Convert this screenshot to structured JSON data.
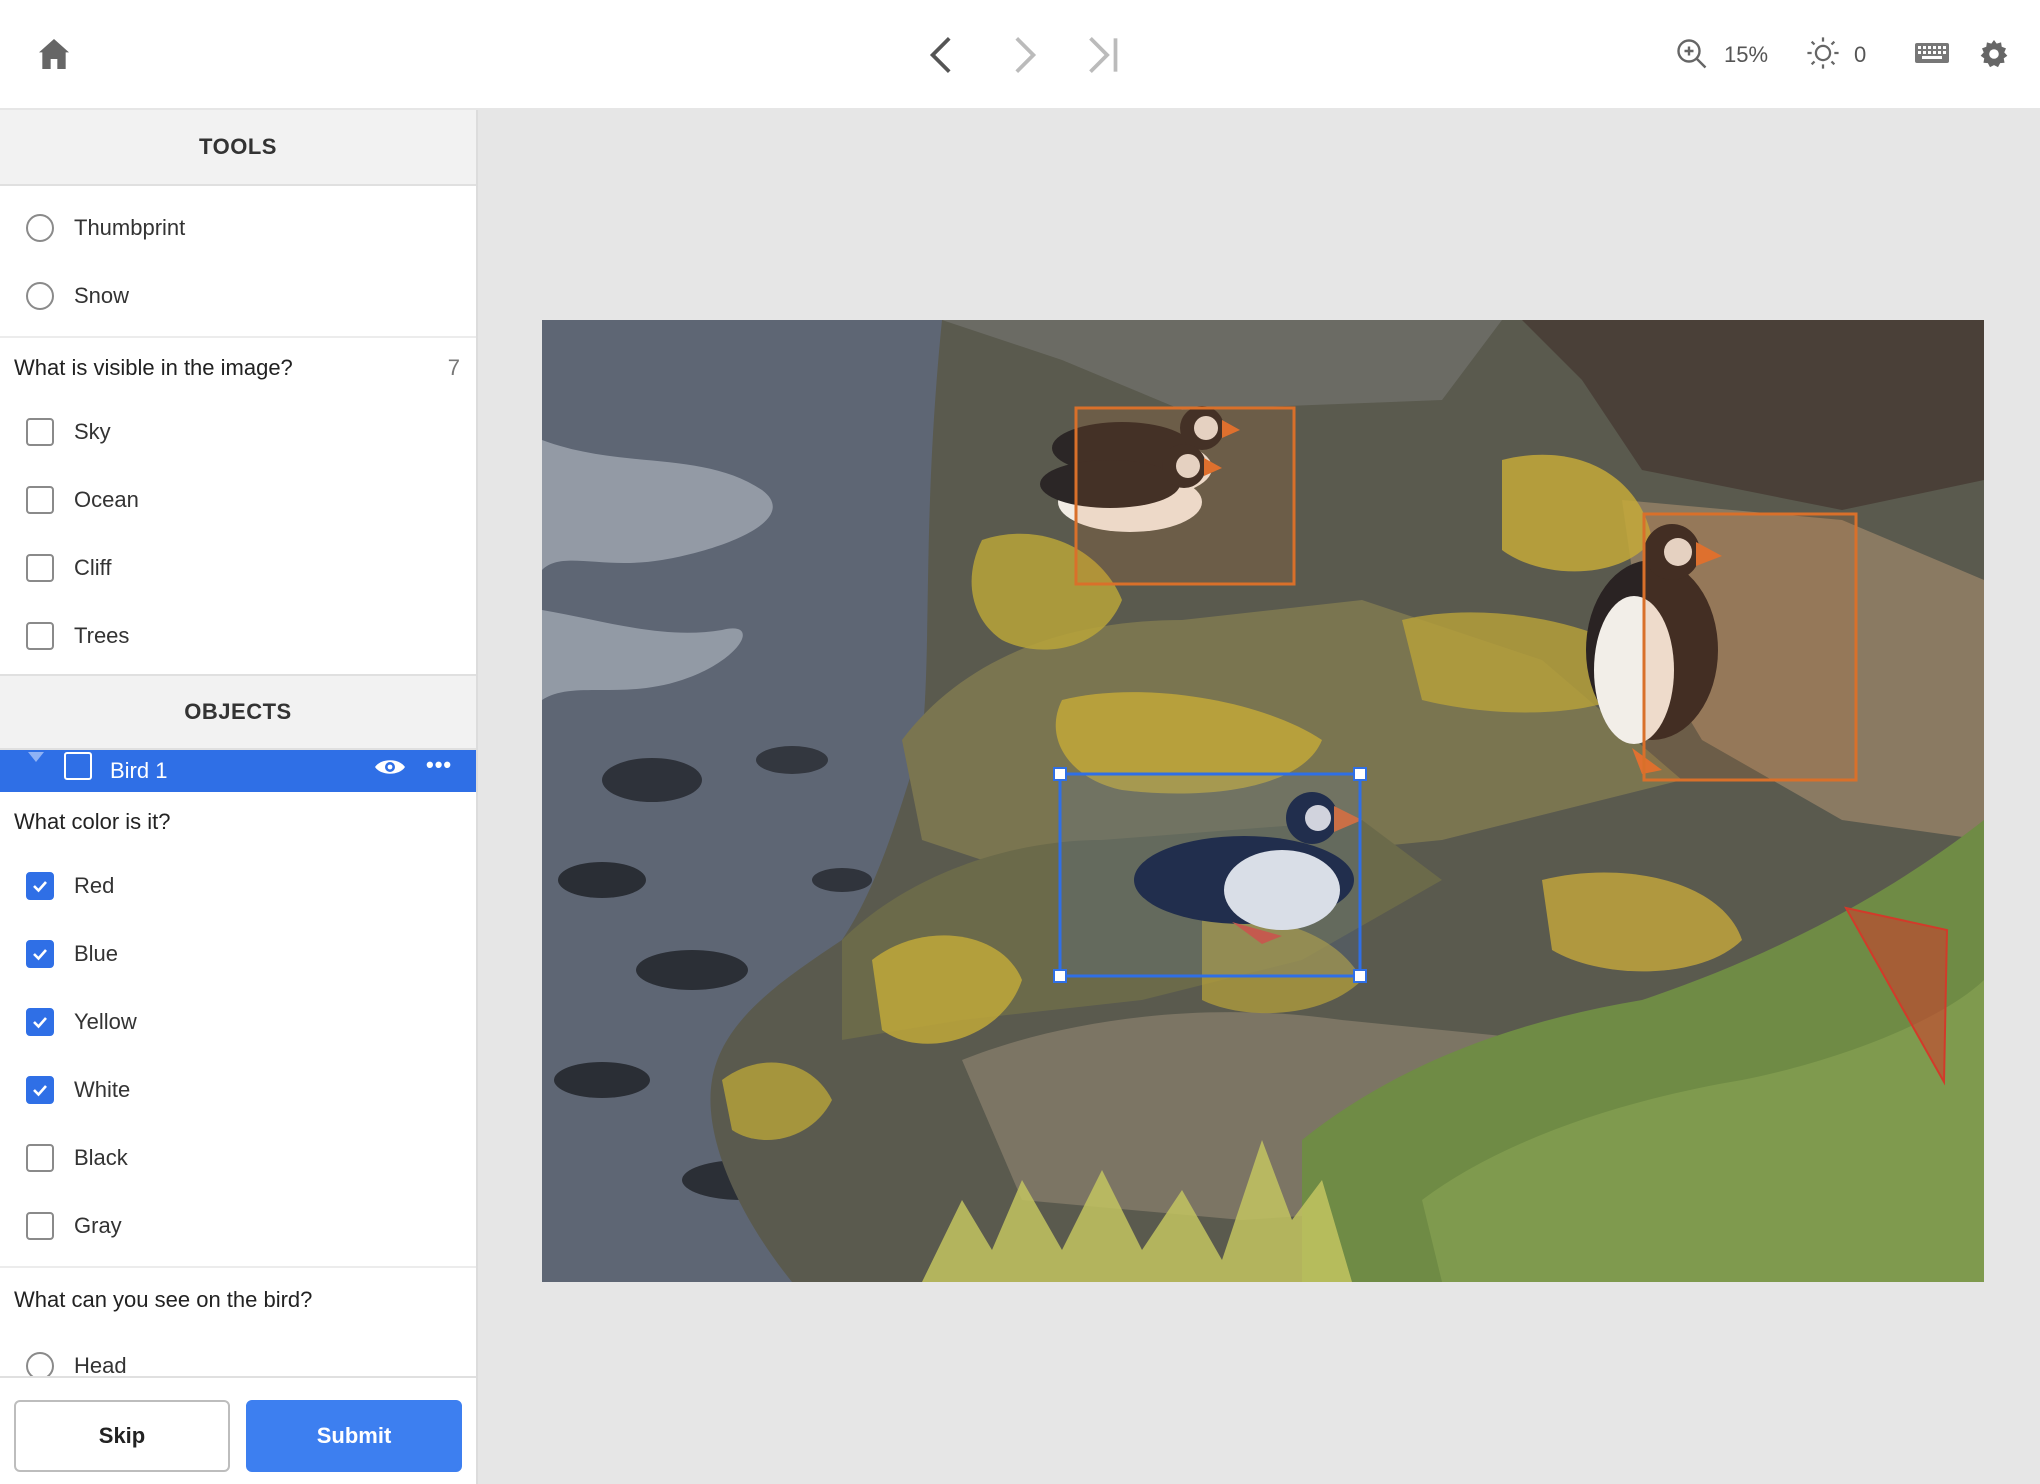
{
  "toolbar": {
    "zoom": "15%",
    "brightness": "0"
  },
  "tools": {
    "header": "TOOLS",
    "items": [
      {
        "label": "Thumbprint"
      },
      {
        "label": "Snow"
      }
    ]
  },
  "visible_question": {
    "text": "What is visible in the image?",
    "count": "7",
    "options": [
      {
        "label": "Sky",
        "checked": false
      },
      {
        "label": "Ocean",
        "checked": false
      },
      {
        "label": "Cliff",
        "checked": false
      },
      {
        "label": "Trees",
        "checked": false
      }
    ]
  },
  "objects": {
    "header": "OBJECTS",
    "selected": {
      "label": "Bird 1"
    }
  },
  "color_question": {
    "text": "What color is it?",
    "options": [
      {
        "label": "Red",
        "checked": true
      },
      {
        "label": "Blue",
        "checked": true
      },
      {
        "label": "Yellow",
        "checked": true
      },
      {
        "label": "White",
        "checked": true
      },
      {
        "label": "Black",
        "checked": false
      },
      {
        "label": "Gray",
        "checked": false
      }
    ]
  },
  "bird_question": {
    "text": "What can you see on the bird?",
    "options": [
      {
        "label": "Head"
      }
    ]
  },
  "footer": {
    "skip": "Skip",
    "submit": "Submit"
  },
  "colors": {
    "accent": "#2f6fe6",
    "annotation_orange": "#d9702a",
    "annotation_red": "#d23a2a"
  }
}
